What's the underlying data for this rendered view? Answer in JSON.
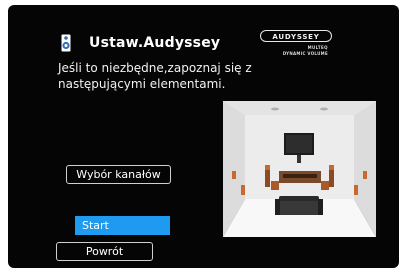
{
  "header": {
    "title": "Ustaw.Audyssey",
    "icon": "speaker-icon"
  },
  "description": "Jeśli to niezbędne,zapoznaj się z następującymi elementami.",
  "logo": {
    "name": "AUDYSSEY",
    "line1": "MULTEQ",
    "line2": "DYNAMIC VOLUME"
  },
  "buttons": {
    "channel_select": "Wybór kanałów",
    "start": "Start",
    "back": "Powrót"
  },
  "colors": {
    "background": "#050505",
    "highlight": "#1e9bf0",
    "text": "#ffffff"
  }
}
